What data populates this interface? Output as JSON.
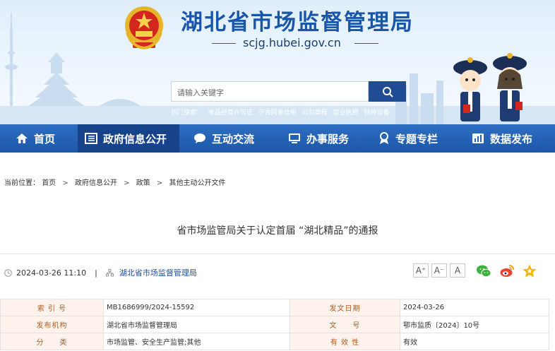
{
  "header": {
    "site_title": "湖北省市场监督管理局",
    "domain": "scjg.hubei.gov.cn",
    "emblem_icon": "national-emblem-icon"
  },
  "search": {
    "placeholder": "请输入关键字",
    "hot_label": "热门搜索：",
    "hot_terms": [
      "食品经营许可证",
      "守合同重信用",
      "公司章程",
      "营业执照",
      "特种设备"
    ]
  },
  "nav": {
    "items": [
      {
        "label": "首页",
        "icon": "home-icon"
      },
      {
        "label": "政府信息公开",
        "icon": "document-list-icon"
      },
      {
        "label": "互动交流",
        "icon": "chat-bubble-icon"
      },
      {
        "label": "办事服务",
        "icon": "monitor-icon"
      },
      {
        "label": "专题专栏",
        "icon": "award-icon"
      },
      {
        "label": "数据发布",
        "icon": "bar-chart-icon"
      }
    ],
    "active_index": 1
  },
  "breadcrumb": {
    "prefix": "当前位置：",
    "items": [
      "首页",
      "政府信息公开",
      "政策",
      "其他主动公开文件"
    ]
  },
  "article": {
    "title": "省市场监管局关于认定首届 “湖北精品”的通报",
    "datetime": "2024-03-26 11:10",
    "separator": "|",
    "source": "湖北省市场监督管理局",
    "font_sizes": [
      "A⁺",
      "A⁻",
      "A"
    ],
    "share_icons": [
      "wechat-icon",
      "weibo-icon",
      "favorite-star-icon"
    ]
  },
  "info_table": {
    "rows": [
      {
        "k1": "索 引 号",
        "v1": "MB1686999/2024-15592",
        "k2": "发文日期",
        "v2": "2024-03-26"
      },
      {
        "k1": "发布机构",
        "v1": "湖北省市场监督管理局",
        "k2": "文　　号",
        "v2": "鄂市监质〔2024〕10号"
      },
      {
        "k1": "分　　类",
        "v1": "市场监管、安全生产监管;其他",
        "k2": "有 效 性",
        "v2": "有效"
      }
    ]
  },
  "colors": {
    "brand_blue": "#1d57a8",
    "nav_active": "#17438a",
    "table_key_bg": "#fdf3ec",
    "table_key_text": "#b05a1f"
  }
}
